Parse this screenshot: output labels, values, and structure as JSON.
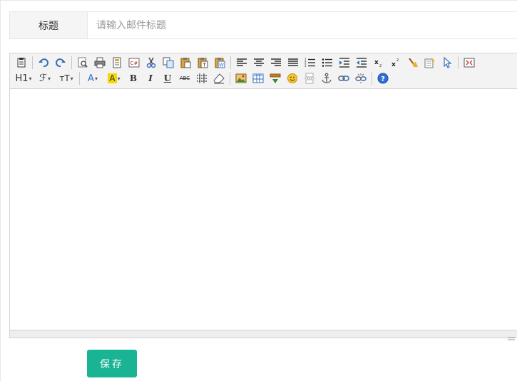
{
  "form": {
    "title_label": "标题",
    "title_placeholder": "请输入邮件标题",
    "title_value": ""
  },
  "toolbar": {
    "row1": [
      "source-icon",
      "undo-icon",
      "redo-icon",
      "preview-icon",
      "print-icon",
      "template-icon",
      "code-icon",
      "cut-icon",
      "copy-icon",
      "paste-icon",
      "paste-text-icon",
      "paste-word-icon",
      "align-left-icon",
      "align-center-icon",
      "align-right-icon",
      "align-justify-icon",
      "ordered-list-icon",
      "unordered-list-icon",
      "indent-icon",
      "outdent-icon",
      "subscript-icon",
      "superscript-icon",
      "clear-format-icon",
      "select-all-icon",
      "cursor-icon",
      "fullscreen-icon"
    ],
    "heading_label": "H1",
    "font_label": "ℱ",
    "size_label": "ᴛT",
    "forecolor_label": "A",
    "backcolor_label": "A",
    "bold_label": "B",
    "italic_label": "I",
    "underline_label": "U",
    "strike_label": "ABC",
    "colors": {
      "accent": "#1ab394",
      "forecolor": "#2f6fd6",
      "backcolor": "#f7d800"
    }
  },
  "save_label": "保存"
}
